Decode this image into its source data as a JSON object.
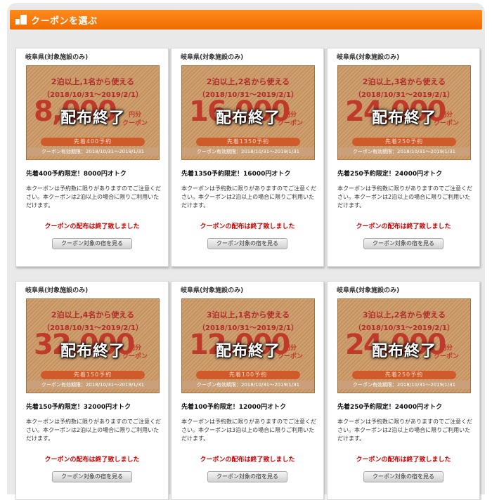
{
  "header": {
    "title": "クーポンを選ぶ",
    "icon": "building-icon",
    "color": "#f07a10"
  },
  "common": {
    "area_label": "岐阜県(対象施設のみ)",
    "unit_label": "円分\nクーポン",
    "ended_overlay": "配布終了",
    "validity": "クーポン有効期限：2018/10/31〜2019/1/31",
    "description_2": "本クーポンは予約数に限りがありますのでご注意ください。本クーポンは2泊以上の場合に限りご利用いただけます。",
    "description_3": "本クーポンは予約数に限りがありますのでご注意ください。本クーポンは3泊以上の場合に限りご利用いただけます。",
    "ended_text": "クーポンの配布は終了致しました",
    "button_label": "クーポン対象の宿を見る"
  },
  "cards": [
    {
      "condition": "2泊以上,1名から使える",
      "period": "（2018/10/31〜2019/2/1）",
      "amount": "8,000",
      "badge": "先着400予約",
      "title": "先着400予約限定！8000円オトク",
      "nights": 2
    },
    {
      "condition": "2泊以上,2名から使える",
      "period": "（2018/10/31〜2019/2/1）",
      "amount": "16,000",
      "badge": "先着1350予約",
      "title": "先着1350予約限定！16000円オトク",
      "nights": 2
    },
    {
      "condition": "2泊以上,3名から使える",
      "period": "（2018/10/31〜2019/2/1）",
      "amount": "24,000",
      "badge": "先着250予約",
      "title": "先着250予約限定！24000円オトク",
      "nights": 2
    },
    {
      "condition": "2泊以上,4名から使える",
      "period": "（2018/10/31〜2019/2/1）",
      "amount": "32,000",
      "badge": "先着150予約",
      "title": "先着150予約限定！32000円オトク",
      "nights": 2
    },
    {
      "condition": "3泊以上,1名から使える",
      "period": "（2018/10/31〜2019/2/1）",
      "amount": "12,000",
      "badge": "先着100予約",
      "title": "先着100予約限定！12000円オトク",
      "nights": 3
    },
    {
      "condition": "3泊以上,2名から使える",
      "period": "（2018/10/31〜2019/2/1）",
      "amount": "24,000",
      "badge": "先着250予約",
      "title": "先着250予約限定！24000円オトク",
      "nights": 2
    }
  ]
}
